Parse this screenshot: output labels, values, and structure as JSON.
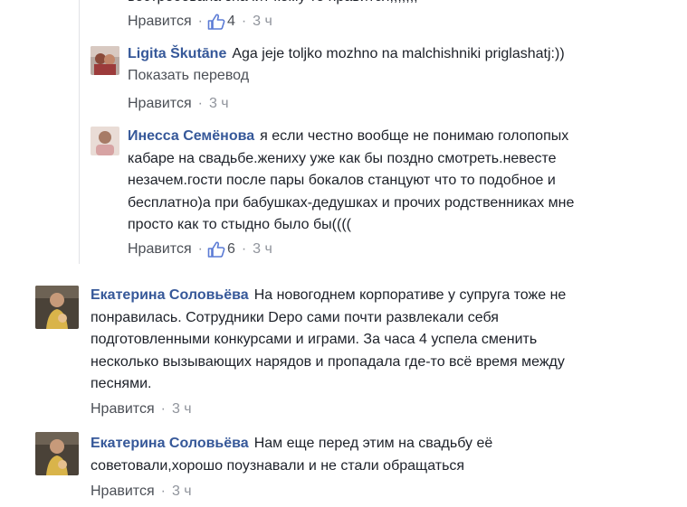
{
  "top_reply": {
    "cut_text": "востребована значит кому то нравится;;;;;;;",
    "like_label": "Нравится",
    "like_count": "4",
    "time": "3 ч",
    "sep": "·"
  },
  "replies": [
    {
      "author": "Ligita Škutāne",
      "text": "Aga jeje toljko mozhno na malchishniki priglashatj:))",
      "translate_label": "Показать перевод",
      "like_label": "Нравится",
      "time": "3 ч"
    },
    {
      "author": "Инесса Семёнова",
      "text_lines": [
        "я если честно вообще не понимаю голопопых",
        "кабаре на свадьбе.жениху уже как бы поздно смотреть.невесте",
        "незачем.гости после пары бокалов станцуют что то подобное и",
        "бесплатно)а при бабушках-дедушках и прочих родственниках мне",
        "просто как то стыдно было бы(((("
      ],
      "like_label": "Нравится",
      "like_count": "6",
      "time": "3 ч"
    }
  ],
  "comments": [
    {
      "author": "Екатерина Соловьёва",
      "text_lines": [
        "На новогоднем корпоративе у супруга тоже не",
        "понравилась. Сотрудники Depo сами почти развлекали себя",
        "подготовленными конкурсами и играми. За часа 4 успела сменить",
        "несколько вызывающих нарядов и пропадала где-то всё время между",
        "песнями."
      ],
      "like_label": "Нравится",
      "time": "3 ч"
    },
    {
      "author": "Екатерина Соловьёва",
      "text_lines": [
        "Нам еще перед этим на свадьбу её",
        "советовали,хорошо поузнавали и не стали обращаться"
      ],
      "like_label": "Нравится",
      "time": "3 ч"
    }
  ],
  "colors": {
    "author": "#365899",
    "text": "#1d2129",
    "meta": "#90949c",
    "link": "#4b4f56"
  },
  "icons": [
    "thumbs-up-icon",
    "avatar"
  ]
}
